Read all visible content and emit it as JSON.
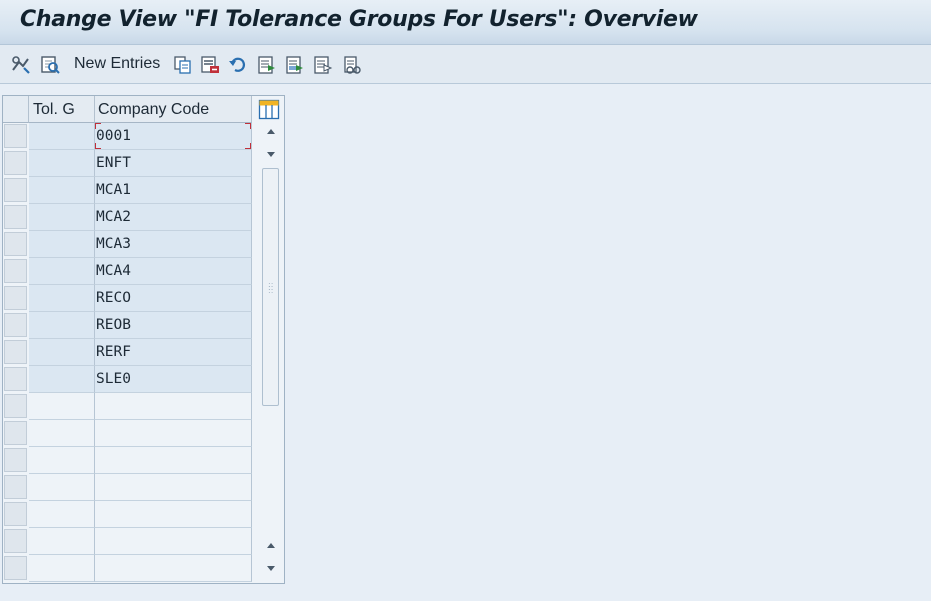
{
  "window": {
    "title": "Change View \"FI Tolerance Groups For Users\": Overview"
  },
  "toolbar": {
    "new_entries_label": "New Entries",
    "icons": [
      "display-change-icon",
      "find-icon",
      "new-entries-button",
      "copy-icon",
      "delete-icon",
      "undo-change-icon",
      "select-all-icon",
      "select-block-icon",
      "deselect-all-icon",
      "print-field-list-icon"
    ]
  },
  "table": {
    "columns": [
      "Tol. G",
      "Company Code"
    ],
    "rows": [
      {
        "tol_group": "",
        "company_code": "0001"
      },
      {
        "tol_group": "",
        "company_code": "ENFT"
      },
      {
        "tol_group": "",
        "company_code": "MCA1"
      },
      {
        "tol_group": "",
        "company_code": "MCA2"
      },
      {
        "tol_group": "",
        "company_code": "MCA3"
      },
      {
        "tol_group": "",
        "company_code": "MCA4"
      },
      {
        "tol_group": "",
        "company_code": "RECO"
      },
      {
        "tol_group": "",
        "company_code": "REOB"
      },
      {
        "tol_group": "",
        "company_code": "RERF"
      },
      {
        "tol_group": "",
        "company_code": "SLE0"
      },
      {
        "tol_group": "",
        "company_code": ""
      },
      {
        "tol_group": "",
        "company_code": ""
      },
      {
        "tol_group": "",
        "company_code": ""
      },
      {
        "tol_group": "",
        "company_code": ""
      },
      {
        "tol_group": "",
        "company_code": ""
      },
      {
        "tol_group": "",
        "company_code": ""
      },
      {
        "tol_group": "",
        "company_code": ""
      }
    ]
  },
  "colors": {
    "background": "#e7eef6",
    "filled_cell": "#dbe7f2",
    "focus_marker": "#c0303a",
    "icon_blue": "#2a6fb0"
  }
}
